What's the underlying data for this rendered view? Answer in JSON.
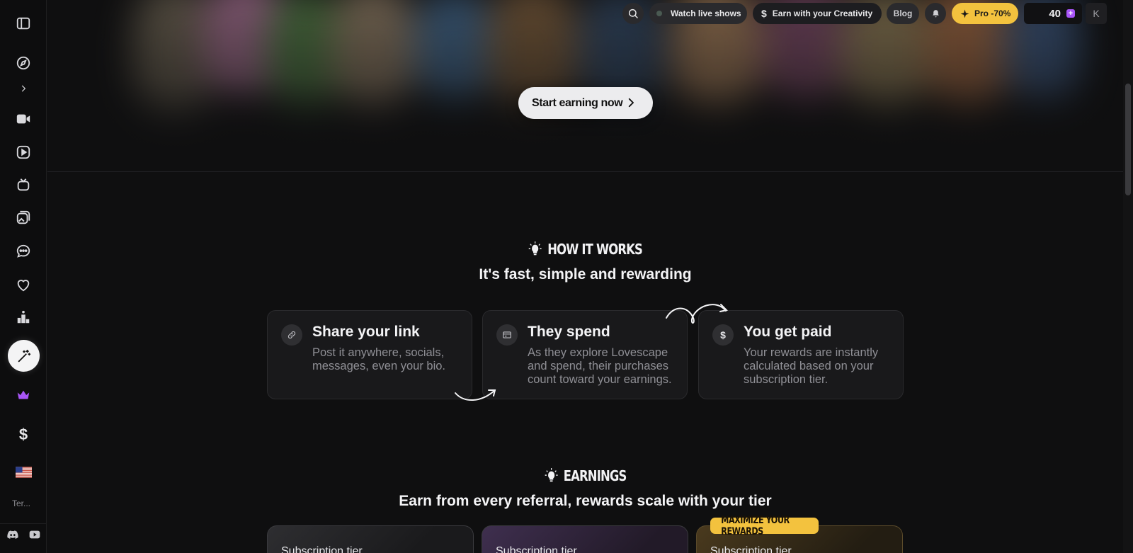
{
  "topbar": {
    "watch_label": "Watch live shows",
    "earn_label": "Earn with your Creativity",
    "blog_label": "Blog",
    "pro_label": "Pro -70%",
    "credits": "40",
    "avatar_initial": "K"
  },
  "hero": {
    "cta_label": "Start earning now"
  },
  "sidebar": {
    "terms": "Ter..."
  },
  "how_it_works": {
    "tag": "HOW IT WORKS",
    "title": "It's fast, simple and rewarding",
    "cards": [
      {
        "title": "Share your link",
        "desc": "Post it anywhere, socials, messages, even your bio.",
        "icon": "link-icon"
      },
      {
        "title": "They spend",
        "desc": "As they explore Lovescape and spend, their purchases count toward your earnings.",
        "icon": "card-icon"
      },
      {
        "title": "You get paid",
        "desc": "Your rewards are instantly calculated based on your subscription tier.",
        "icon": "dollar-icon"
      }
    ]
  },
  "earnings": {
    "tag": "EARNINGS",
    "title": "Earn from every referral, rewards scale with your tier",
    "badge": "MAXIMIZE YOUR REWARDS",
    "tiers": [
      {
        "label": "Subscription tier"
      },
      {
        "label": "Subscription tier"
      },
      {
        "label": "Subscription tier"
      }
    ]
  },
  "colors": {
    "accent_gold": "#f3c23e",
    "accent_purple": "#a855f7",
    "background": "#0f0f10"
  }
}
